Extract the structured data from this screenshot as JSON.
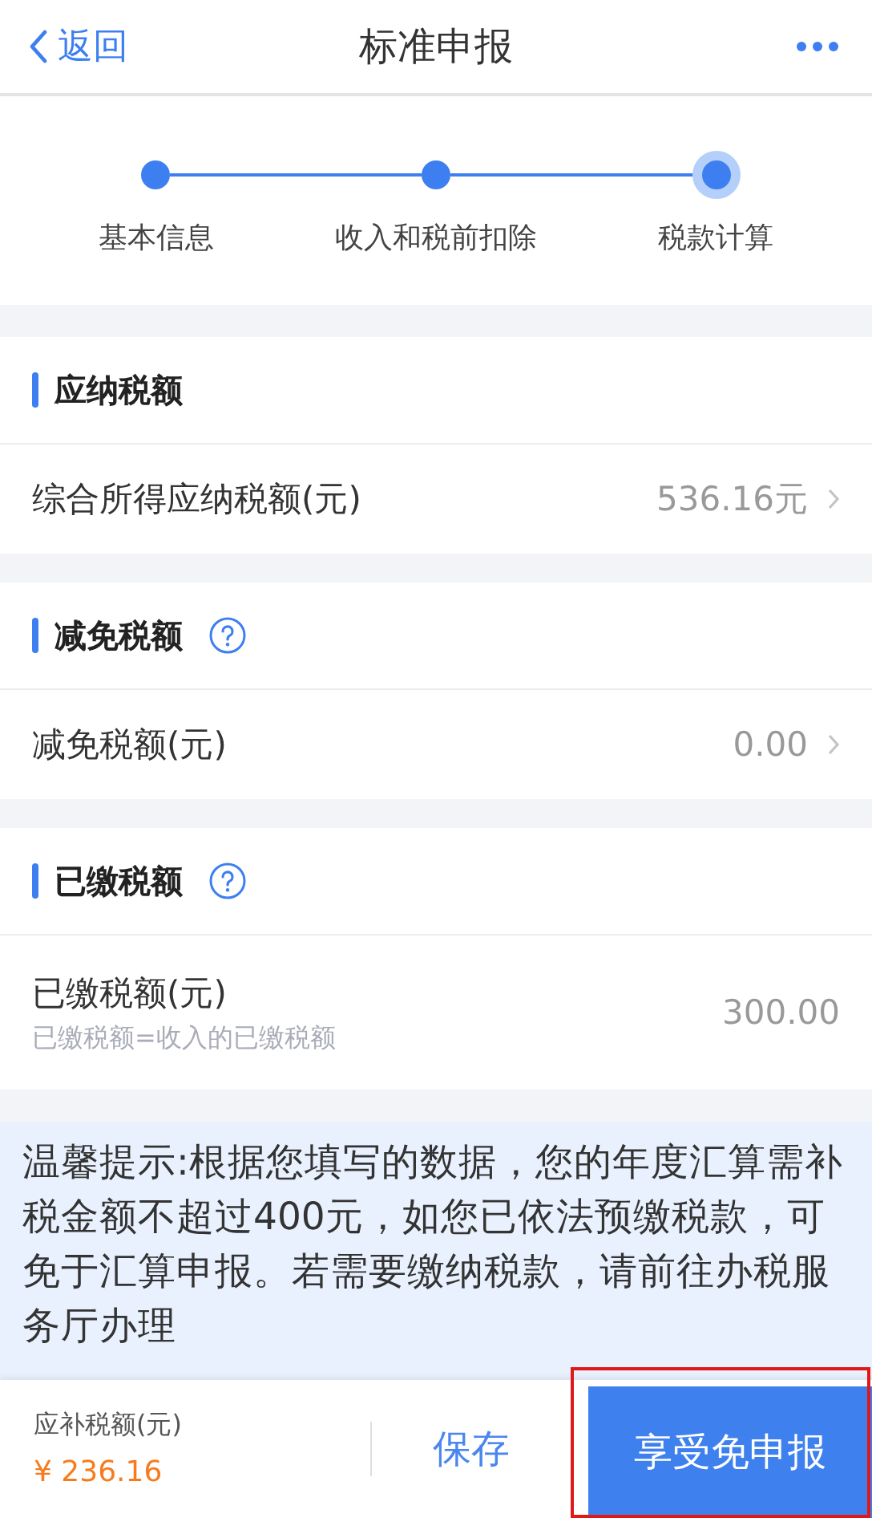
{
  "nav": {
    "back": "返回",
    "title": "标准申报"
  },
  "steps": [
    {
      "label": "基本信息",
      "current": false
    },
    {
      "label": "收入和税前扣除",
      "current": false
    },
    {
      "label": "税款计算",
      "current": true
    }
  ],
  "sections": [
    {
      "title": "应纳税额",
      "help": false,
      "rows": [
        {
          "label": "综合所得应纳税额(元)",
          "value": "536.16元",
          "chevron": true
        }
      ]
    },
    {
      "title": "减免税额",
      "help": true,
      "rows": [
        {
          "label": "减免税额(元)",
          "value": "0.00",
          "chevron": true
        }
      ]
    },
    {
      "title": "已缴税额",
      "help": true,
      "rows": [
        {
          "label": "已缴税额(元)",
          "note": "已缴税额=收入的已缴税额",
          "value": "300.00",
          "chevron": false
        }
      ]
    }
  ],
  "notice": "温馨提示:根据您填写的数据，您的年度汇算需补税金额不超过400元，如您已依法预缴税款，可免于汇算申报。若需要缴纳税款，请前往办税服务厅办理",
  "footer": {
    "label": "应补税额(元)",
    "amount": "¥ 236.16",
    "save": "保存",
    "submit": "享受免申报",
    "submit_highlighted": true
  }
}
